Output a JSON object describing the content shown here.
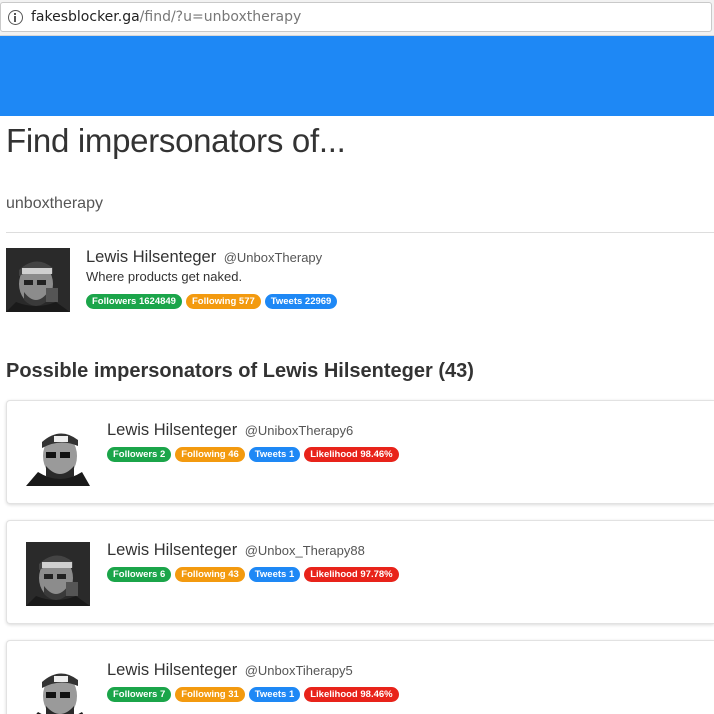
{
  "browser": {
    "url_host": "fakesblocker.ga",
    "url_path": "/find/?u=unboxtherapy"
  },
  "page": {
    "title": "Find impersonators of...",
    "query": "unboxtherapy"
  },
  "profile": {
    "name": "Lewis Hilsenteger",
    "handle": "@UnboxTherapy",
    "bio": "Where products get naked.",
    "followers": "Followers 1624849",
    "following": "Following 577",
    "tweets": "Tweets 22969"
  },
  "section": {
    "title": "Possible impersonators of Lewis Hilsenteger (43)"
  },
  "impersonators": [
    {
      "name": "Lewis Hilsenteger",
      "handle": "@UniboxTherapy6",
      "followers": "Followers 2",
      "following": "Following 46",
      "tweets": "Tweets 1",
      "likelihood": "Likelihood 98.46%"
    },
    {
      "name": "Lewis Hilsenteger",
      "handle": "@Unbox_Therapy88",
      "followers": "Followers 6",
      "following": "Following 43",
      "tweets": "Tweets 1",
      "likelihood": "Likelihood 97.78%"
    },
    {
      "name": "Lewis Hilsenteger",
      "handle": "@UnboxTiherapy5",
      "followers": "Followers 7",
      "following": "Following 31",
      "tweets": "Tweets 1",
      "likelihood": "Likelihood 98.46%"
    }
  ],
  "colors": {
    "nav": "#1e88f5",
    "followers": "#1ba54a",
    "following": "#f39a0f",
    "tweets": "#1e88f5",
    "likelihood": "#e8231a"
  }
}
